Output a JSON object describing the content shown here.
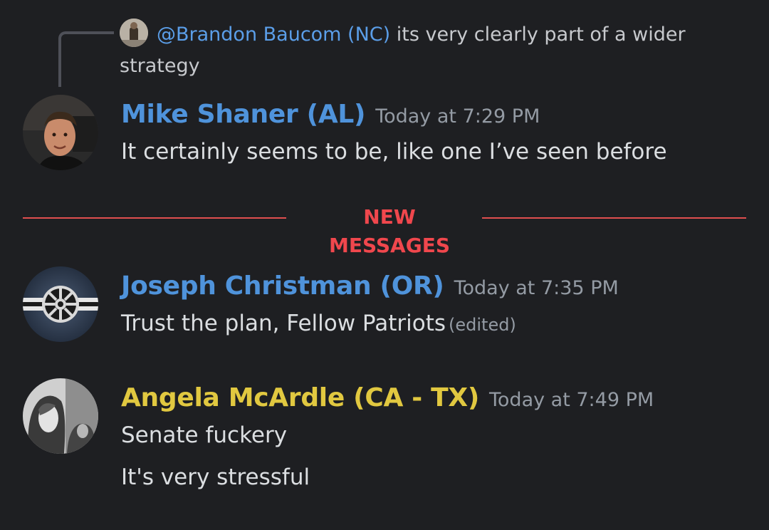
{
  "reply": {
    "mention": "@Brandon Baucom (NC)",
    "text": " its very clearly part of a wider strategy"
  },
  "messages": [
    {
      "author": "Mike Shaner (AL)",
      "author_color": "#4f93db",
      "timestamp": "Today at 7:29 PM",
      "lines": [
        "It certainly seems to be, like one I’ve seen before"
      ]
    },
    {
      "author": "Joseph Christman (OR)",
      "author_color": "#4f93db",
      "timestamp": "Today at 7:35 PM",
      "lines": [
        "Trust the plan, Fellow Patriots"
      ],
      "edited_label": "(edited)"
    },
    {
      "author": "Angela McArdle (CA - TX)",
      "author_color": "#e1c840",
      "timestamp": "Today at 7:49 PM",
      "lines": [
        "Senate fuckery",
        "It's very stressful"
      ]
    }
  ],
  "divider": {
    "label": "NEW MESSAGES",
    "color": "#f0474d"
  },
  "colors": {
    "background": "#1e1f22",
    "mention": "#5b9ee8",
    "timestamp": "#949ba4"
  }
}
